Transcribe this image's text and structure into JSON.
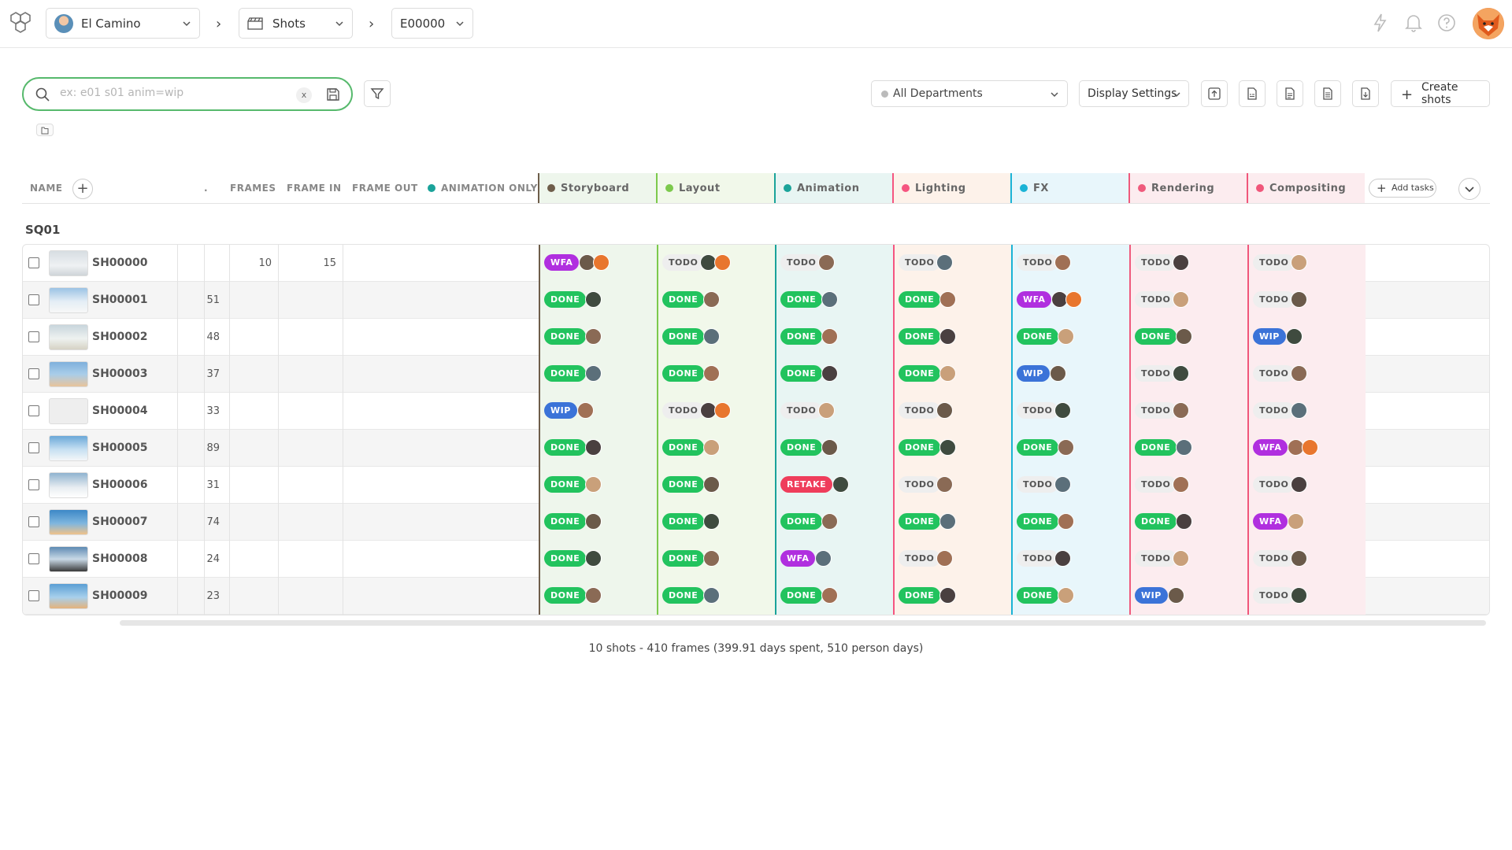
{
  "header": {
    "production": "El Camino",
    "section": "Shots",
    "episode": "E00000"
  },
  "toolbar": {
    "search_placeholder": "ex: e01 s01 anim=wip",
    "clear_label": "x",
    "department": "All Departments",
    "display_settings": "Display Settings",
    "create_shots": "Create shots"
  },
  "columns": {
    "name": "NAME",
    "ellipsis": ".",
    "frames": "FRAMES",
    "frame_in": "FRAME IN",
    "frame_out": "FRAME OUT",
    "animation_only": "ANIMATION ONLY",
    "add_tasks": "Add tasks"
  },
  "task_columns": [
    {
      "name": "Storyboard",
      "color": "#6e5d4a",
      "tint": "#eef6ec"
    },
    {
      "name": "Layout",
      "color": "#7cc94c",
      "tint": "#f1f8ea"
    },
    {
      "name": "Animation",
      "color": "#1aa39a",
      "tint": "#e8f5f3"
    },
    {
      "name": "Lighting",
      "color": "#f55580",
      "tint": "#fdf2ea"
    },
    {
      "name": "FX",
      "color": "#1ab3d6",
      "tint": "#e8f6fb"
    },
    {
      "name": "Rendering",
      "color": "#ef5a7c",
      "tint": "#fcecef"
    },
    {
      "name": "Compositing",
      "color": "#f0567a",
      "tint": "#fcecef"
    }
  ],
  "sequence": "SQ01",
  "shots": [
    {
      "name": "SH00000",
      "frames": "",
      "frame_in": "10",
      "frame_out": "15",
      "tasks": [
        [
          "WFA",
          2
        ],
        [
          "TODO",
          2
        ],
        [
          "TODO",
          1
        ],
        [
          "TODO",
          1
        ],
        [
          "TODO",
          1
        ],
        [
          "TODO",
          1
        ],
        [
          "TODO",
          1
        ]
      ]
    },
    {
      "name": "SH00001",
      "frames": "51",
      "frame_in": "",
      "frame_out": "",
      "tasks": [
        [
          "DONE",
          1
        ],
        [
          "DONE",
          1
        ],
        [
          "DONE",
          1
        ],
        [
          "DONE",
          1
        ],
        [
          "WFA",
          2
        ],
        [
          "TODO",
          1
        ],
        [
          "TODO",
          1
        ]
      ]
    },
    {
      "name": "SH00002",
      "frames": "48",
      "frame_in": "",
      "frame_out": "",
      "tasks": [
        [
          "DONE",
          1
        ],
        [
          "DONE",
          1
        ],
        [
          "DONE",
          1
        ],
        [
          "DONE",
          1
        ],
        [
          "DONE",
          1
        ],
        [
          "DONE",
          1
        ],
        [
          "WIP",
          1
        ]
      ]
    },
    {
      "name": "SH00003",
      "frames": "37",
      "frame_in": "",
      "frame_out": "",
      "tasks": [
        [
          "DONE",
          1
        ],
        [
          "DONE",
          1
        ],
        [
          "DONE",
          1
        ],
        [
          "DONE",
          1
        ],
        [
          "WIP",
          1
        ],
        [
          "TODO",
          1
        ],
        [
          "TODO",
          1
        ]
      ]
    },
    {
      "name": "SH00004",
      "frames": "33",
      "frame_in": "",
      "frame_out": "",
      "tasks": [
        [
          "WIP",
          1
        ],
        [
          "TODO",
          2
        ],
        [
          "TODO",
          1
        ],
        [
          "TODO",
          1
        ],
        [
          "TODO",
          1
        ],
        [
          "TODO",
          1
        ],
        [
          "TODO",
          1
        ]
      ]
    },
    {
      "name": "SH00005",
      "frames": "89",
      "frame_in": "",
      "frame_out": "",
      "tasks": [
        [
          "DONE",
          1
        ],
        [
          "DONE",
          1
        ],
        [
          "DONE",
          1
        ],
        [
          "DONE",
          1
        ],
        [
          "DONE",
          1
        ],
        [
          "DONE",
          1
        ],
        [
          "WFA",
          2
        ]
      ]
    },
    {
      "name": "SH00006",
      "frames": "31",
      "frame_in": "",
      "frame_out": "",
      "tasks": [
        [
          "DONE",
          1
        ],
        [
          "DONE",
          1
        ],
        [
          "RETAKE",
          1
        ],
        [
          "TODO",
          1
        ],
        [
          "TODO",
          1
        ],
        [
          "TODO",
          1
        ],
        [
          "TODO",
          1
        ]
      ]
    },
    {
      "name": "SH00007",
      "frames": "74",
      "frame_in": "",
      "frame_out": "",
      "tasks": [
        [
          "DONE",
          1
        ],
        [
          "DONE",
          1
        ],
        [
          "DONE",
          1
        ],
        [
          "DONE",
          1
        ],
        [
          "DONE",
          1
        ],
        [
          "DONE",
          1
        ],
        [
          "WFA",
          1
        ]
      ]
    },
    {
      "name": "SH00008",
      "frames": "24",
      "frame_in": "",
      "frame_out": "",
      "tasks": [
        [
          "DONE",
          1
        ],
        [
          "DONE",
          1
        ],
        [
          "WFA",
          1
        ],
        [
          "TODO",
          1
        ],
        [
          "TODO",
          1
        ],
        [
          "TODO",
          1
        ],
        [
          "TODO",
          1
        ]
      ]
    },
    {
      "name": "SH00009",
      "frames": "23",
      "frame_in": "",
      "frame_out": "",
      "tasks": [
        [
          "DONE",
          1
        ],
        [
          "DONE",
          1
        ],
        [
          "DONE",
          1
        ],
        [
          "DONE",
          1
        ],
        [
          "DONE",
          1
        ],
        [
          "WIP",
          1
        ],
        [
          "TODO",
          1
        ]
      ]
    }
  ],
  "footer": "10 shots - 410 frames (399.91 days spent, 510 person days)",
  "colors": {
    "accent": "#56b96c",
    "done": "#22c35e",
    "wfa": "#b02fdf",
    "wip": "#3b73d8",
    "retake": "#ef3d5b",
    "todo": "#eeeeee"
  }
}
